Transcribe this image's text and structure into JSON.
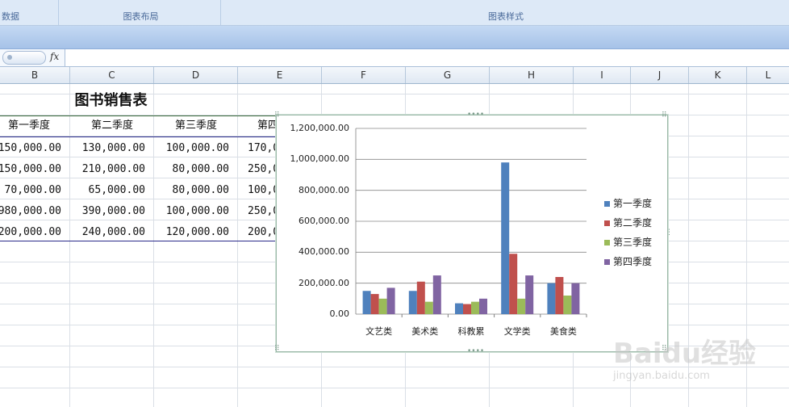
{
  "ribbon": {
    "groups": [
      {
        "label": "数据"
      },
      {
        "label": "图表布局"
      },
      {
        "label": "图表样式"
      }
    ]
  },
  "formula_bar": {
    "fx_label": "fx",
    "value": ""
  },
  "columns": [
    "B",
    "C",
    "D",
    "E",
    "F",
    "G",
    "H",
    "I",
    "J",
    "K",
    "L"
  ],
  "sheet": {
    "title": "图书销售表",
    "headers": [
      "第一季度",
      "第二季度",
      "第三季度",
      "第四"
    ],
    "rows": [
      [
        "150,000.00",
        "130,000.00",
        "100,000.00",
        "170,0"
      ],
      [
        "150,000.00",
        "210,000.00",
        "80,000.00",
        "250,0"
      ],
      [
        "70,000.00",
        "65,000.00",
        "80,000.00",
        "100,0"
      ],
      [
        "980,000.00",
        "390,000.00",
        "100,000.00",
        "250,0"
      ],
      [
        "200,000.00",
        "240,000.00",
        "120,000.00",
        "200,0"
      ]
    ]
  },
  "chart_data": {
    "type": "bar",
    "categories": [
      "文艺类",
      "美术类",
      "科教累",
      "文学类",
      "美食类"
    ],
    "series": [
      {
        "name": "第一季度",
        "color": "#4f81bd",
        "values": [
          150000,
          150000,
          70000,
          980000,
          200000
        ]
      },
      {
        "name": "第二季度",
        "color": "#c0504d",
        "values": [
          130000,
          210000,
          65000,
          390000,
          240000
        ]
      },
      {
        "name": "第三季度",
        "color": "#9bbb59",
        "values": [
          100000,
          80000,
          80000,
          100000,
          120000
        ]
      },
      {
        "name": "第四季度",
        "color": "#8064a2",
        "values": [
          170000,
          250000,
          100000,
          250000,
          200000
        ]
      }
    ],
    "ylim": [
      0,
      1200000
    ],
    "yticks": [
      "0.00",
      "200,000.00",
      "400,000.00",
      "600,000.00",
      "800,000.00",
      "1,000,000.00",
      "1,200,000.00"
    ],
    "grid": true,
    "legend": "right"
  },
  "watermark": {
    "brand": "Baidu经验",
    "url": "jingyan.baidu.com"
  }
}
